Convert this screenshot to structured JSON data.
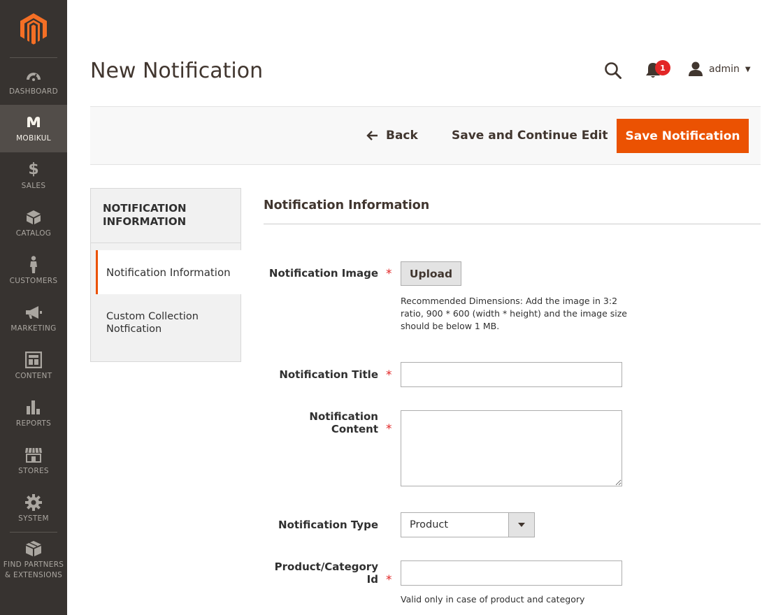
{
  "sidebar": {
    "items": [
      {
        "label": "DASHBOARD",
        "icon": "dashboard-icon"
      },
      {
        "label": "MOBIKUL",
        "icon": "mobikul-icon",
        "active": true
      },
      {
        "label": "SALES",
        "icon": "dollar-icon"
      },
      {
        "label": "CATALOG",
        "icon": "box-icon"
      },
      {
        "label": "CUSTOMERS",
        "icon": "person-icon"
      },
      {
        "label": "MARKETING",
        "icon": "megaphone-icon"
      },
      {
        "label": "CONTENT",
        "icon": "layout-icon"
      },
      {
        "label": "REPORTS",
        "icon": "bar-chart-icon"
      },
      {
        "label": "STORES",
        "icon": "storefront-icon"
      },
      {
        "label": "SYSTEM",
        "icon": "gear-icon"
      },
      {
        "label": "FIND PARTNERS\n& EXTENSIONS",
        "label_line1": "FIND PARTNERS",
        "label_line2": "& EXTENSIONS",
        "icon": "extensions-icon"
      }
    ]
  },
  "header": {
    "title": "New Notification",
    "notification_count": "1",
    "user_name": "admin"
  },
  "actions": {
    "back_label": "Back",
    "continue_label": "Save and Continue Edit",
    "save_label": "Save Notification"
  },
  "tabs": {
    "heading_line1": "NOTIFICATION",
    "heading_line2": "INFORMATION",
    "items": [
      {
        "label": "Notification Information",
        "active": true
      },
      {
        "label_line1": "Custom Collection",
        "label_line2": "Notfication"
      }
    ]
  },
  "form": {
    "section_title": "Notification Information",
    "image_label": "Notification Image",
    "upload_label": "Upload",
    "image_note": "Recommended Dimensions: Add the image in 3:2 ratio, 900 * 600 (width * height) and the image size should be below 1 MB.",
    "title_label": "Notification Title",
    "title_value": "",
    "content_label_line1": "Notification",
    "content_label_line2": "Content",
    "content_value": "",
    "type_label": "Notification Type",
    "type_value": "Product",
    "id_label_line1": "Product/Category",
    "id_label_line2": "Id",
    "id_value": "",
    "id_note": "Valid only in case of product and category",
    "required_mark": "*"
  },
  "colors": {
    "sidebar_bg": "#373330",
    "sidebar_active_bg": "#524d49",
    "accent": "#eb5202",
    "required": "#e22626",
    "badge": "#e22626"
  }
}
